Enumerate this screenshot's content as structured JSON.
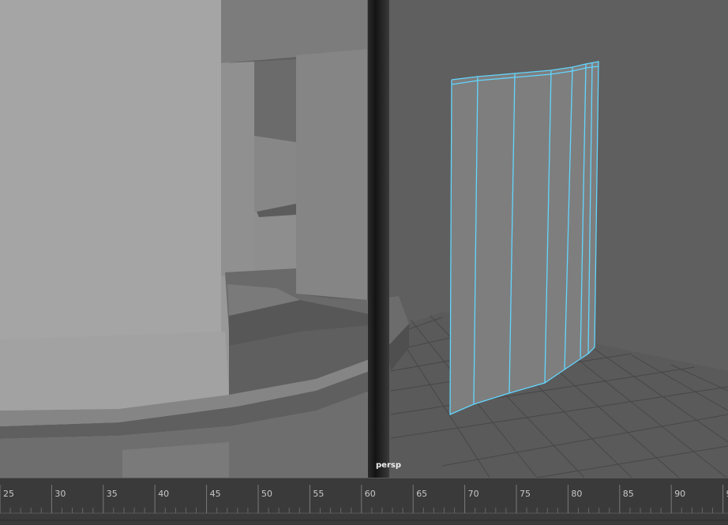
{
  "viewport": {
    "camera_name": "persp"
  },
  "timeline": {
    "frames": [
      "25",
      "30",
      "35",
      "40",
      "45",
      "50",
      "55",
      "60",
      "65",
      "70",
      "75",
      "80",
      "85",
      "90",
      "9"
    ]
  },
  "colors": {
    "selection_wireframe": "#62d6ff",
    "viewport_background": "#5e5e5e",
    "timeline_background": "#3a3a3a"
  }
}
